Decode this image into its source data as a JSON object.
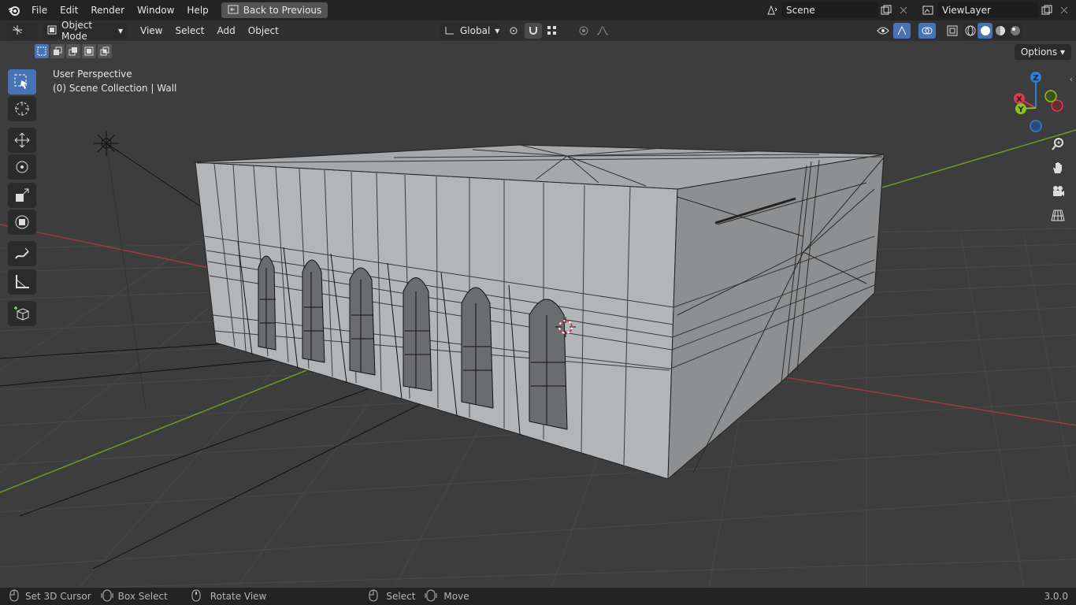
{
  "menubar": {
    "items": [
      "File",
      "Edit",
      "Render",
      "Window",
      "Help"
    ],
    "back_button": "Back to Previous"
  },
  "scene": {
    "label": "Scene"
  },
  "view_layer": {
    "label": "ViewLayer"
  },
  "header": {
    "mode": "Object Mode",
    "menus": [
      "View",
      "Select",
      "Add",
      "Object"
    ],
    "orientation": "Global",
    "options": "Options"
  },
  "viewport": {
    "perspective": "User Perspective",
    "collection": "(0) Scene Collection | Wall"
  },
  "gizmo": {
    "x": "X",
    "y": "Y",
    "z": "Z"
  },
  "statusbar": {
    "items": [
      "Set 3D Cursor",
      "Box Select",
      "Rotate View",
      "Select",
      "Move"
    ],
    "version": "3.0.0"
  },
  "colors": {
    "accent": "#4772b3",
    "x_axis": "#dc3a4c",
    "y_axis": "#8bc220",
    "z_axis": "#2f7fd8"
  }
}
